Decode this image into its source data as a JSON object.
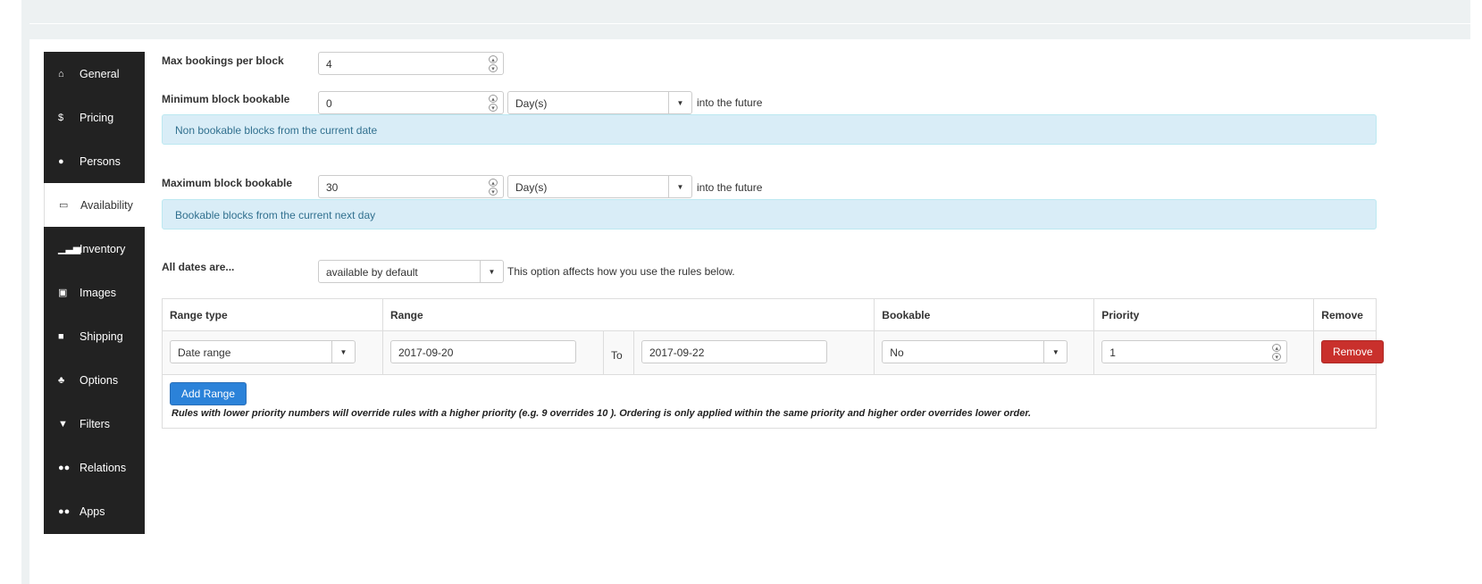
{
  "sidebar": {
    "items": [
      {
        "label": "General",
        "icon": "home-icon",
        "glyph": "⌂"
      },
      {
        "label": "Pricing",
        "icon": "dollar-icon",
        "glyph": "$"
      },
      {
        "label": "Persons",
        "icon": "user-icon",
        "glyph": "●"
      },
      {
        "label": "Availability",
        "icon": "calendar-icon",
        "glyph": "▭"
      },
      {
        "label": "Inventory",
        "icon": "signal-icon",
        "glyph": "▁▃▅"
      },
      {
        "label": "Images",
        "icon": "image-icon",
        "glyph": "▣"
      },
      {
        "label": "Shipping",
        "icon": "truck-icon",
        "glyph": "■"
      },
      {
        "label": "Options",
        "icon": "sitemap-icon",
        "glyph": "♣"
      },
      {
        "label": "Filters",
        "icon": "filter-icon",
        "glyph": "▼"
      },
      {
        "label": "Relations",
        "icon": "users-icon",
        "glyph": "●●"
      },
      {
        "label": "Apps",
        "icon": "users-icon",
        "glyph": "●●"
      }
    ],
    "active": "Availability"
  },
  "form": {
    "max_bookings": {
      "label": "Max bookings per block",
      "value": "4"
    },
    "min_block": {
      "label": "Minimum block bookable",
      "value": "0",
      "unit": "Day(s)",
      "suffix": "into the future",
      "info": "Non bookable blocks from the current date"
    },
    "max_block": {
      "label": "Maximum block bookable",
      "value": "30",
      "unit": "Day(s)",
      "suffix": "into the future",
      "info": "Bookable blocks from the current next day"
    },
    "all_dates": {
      "label": "All dates are...",
      "value": "available by default",
      "hint": "This option affects how you use the rules below."
    }
  },
  "rules": {
    "headers": [
      "Range type",
      "Range",
      "Bookable",
      "Priority",
      "Remove"
    ],
    "rows": [
      {
        "range_type": "Date range",
        "from": "2017-09-20",
        "to_label": "To",
        "to": "2017-09-22",
        "bookable": "No",
        "priority": "1",
        "remove": "Remove"
      }
    ],
    "add_label": "Add Range",
    "note": "Rules with lower priority numbers will override rules with a higher priority (e.g. 9 overrides 10 ). Ordering is only applied within the same priority and higher order overrides lower order."
  },
  "colors": {
    "sidebar": "#222222",
    "info_bg": "#d9edf7",
    "remove": "#c9302c",
    "add": "#2b82d9"
  }
}
